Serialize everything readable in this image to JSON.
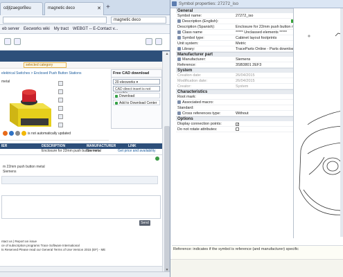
{
  "browser": {
    "tabs": [
      {
        "label": "cdjtjzaegorBeu"
      },
      {
        "label": "magnetic deco"
      }
    ],
    "search_value": "magnetic deco",
    "bookmarks": [
      "eb server",
      "Eecworks wiki",
      "My tract",
      "WEBGT -- E-Contact v..."
    ],
    "category_label": "selected category",
    "breadcrumb": "elektrical Switches > Enclosed Push Button Stations",
    "section_label": "metal",
    "update_note": "is not automatically updated",
    "cad_panel": {
      "title": "Free CAD download",
      "selected": "20 elecworks",
      "option2": "CAD direct insert is not possible",
      "download_label": "Download",
      "add_label": "Add to Download Center"
    },
    "grid_headers": [
      "IER",
      "DESCRIPTION",
      "MANUFACTURER",
      "LINK"
    ],
    "grid_row": [
      "",
      "Enclosure for 22mm push button metal",
      "Siemens",
      "Get price and availability"
    ],
    "row_desc1": "m 22mm push button metal",
    "row_desc2": "Siemens",
    "send_label": "Send",
    "footer": [
      "ntact us | Report an issue",
      "ce of subscription programs  Trace Software International",
      "ts Reserved  Please read our General Terms of Use Version 2015 (EF) - ME"
    ]
  },
  "cadwin": {
    "title": "Symbol properties: 27272_iso",
    "sections": [
      {
        "name": "General",
        "rows": [
          {
            "k": "Symbol name:",
            "v": "27272_iso",
            "mark": false,
            "dim": false
          },
          {
            "k": "Description (English):",
            "v": "",
            "mark": true,
            "dim": false
          },
          {
            "k": "Description (Spanish):",
            "v": "Enclosure for 22mm push button metal",
            "mark": false,
            "dim": false
          },
          {
            "k": "Class name",
            "v": "***** Unclassed elements *****",
            "mark": true,
            "dim": false
          },
          {
            "k": "Symbol type:",
            "v": "Cabinet layout footprints",
            "mark": true,
            "dim": false
          },
          {
            "k": "Unit system:",
            "v": "Metric",
            "mark": false,
            "dim": false
          },
          {
            "k": "Library:",
            "v": "TraceParts Online - Parts downloaded",
            "mark": true,
            "dim": false
          }
        ]
      },
      {
        "name": "Manufacturer part",
        "rows": [
          {
            "k": "Manufacturer:",
            "v": "Siemens",
            "mark": true,
            "dim": false
          },
          {
            "k": "Reference:",
            "v": "3SB3801 2EF3",
            "mark": false,
            "dim": false
          }
        ]
      },
      {
        "name": "System",
        "rows": [
          {
            "k": "Creation date:",
            "v": "26/04/2015",
            "mark": false,
            "dim": true
          },
          {
            "k": "Modification date:",
            "v": "26/04/2015",
            "mark": false,
            "dim": true
          },
          {
            "k": "Creator:",
            "v": "System",
            "mark": false,
            "dim": true
          }
        ]
      },
      {
        "name": "Characteristics",
        "rows": [
          {
            "k": "Root mark:",
            "v": "",
            "mark": false,
            "dim": false
          },
          {
            "k": "Associated macro:",
            "v": "",
            "mark": true,
            "dim": false
          },
          {
            "k": "Standard:",
            "v": "",
            "mark": false,
            "dim": false
          },
          {
            "k": "Cross references type:",
            "v": "Without",
            "mark": true,
            "dim": false
          }
        ]
      },
      {
        "name": "Options",
        "rows": [
          {
            "k": "Display connection points:",
            "v": "✓",
            "mark": false,
            "dim": false,
            "check": true
          },
          {
            "k": "Do not rotate attributes:",
            "v": "",
            "mark": false,
            "dim": false,
            "check": true
          }
        ]
      }
    ],
    "help_text": "Reference: indicates if the symbol is reference (and manufacturer) specific"
  },
  "colors": {
    "header_blue": "#2d4f7a",
    "accent_green": "#35a246",
    "product_yellow": "#e6cf1b",
    "product_red": "#c8202a"
  }
}
